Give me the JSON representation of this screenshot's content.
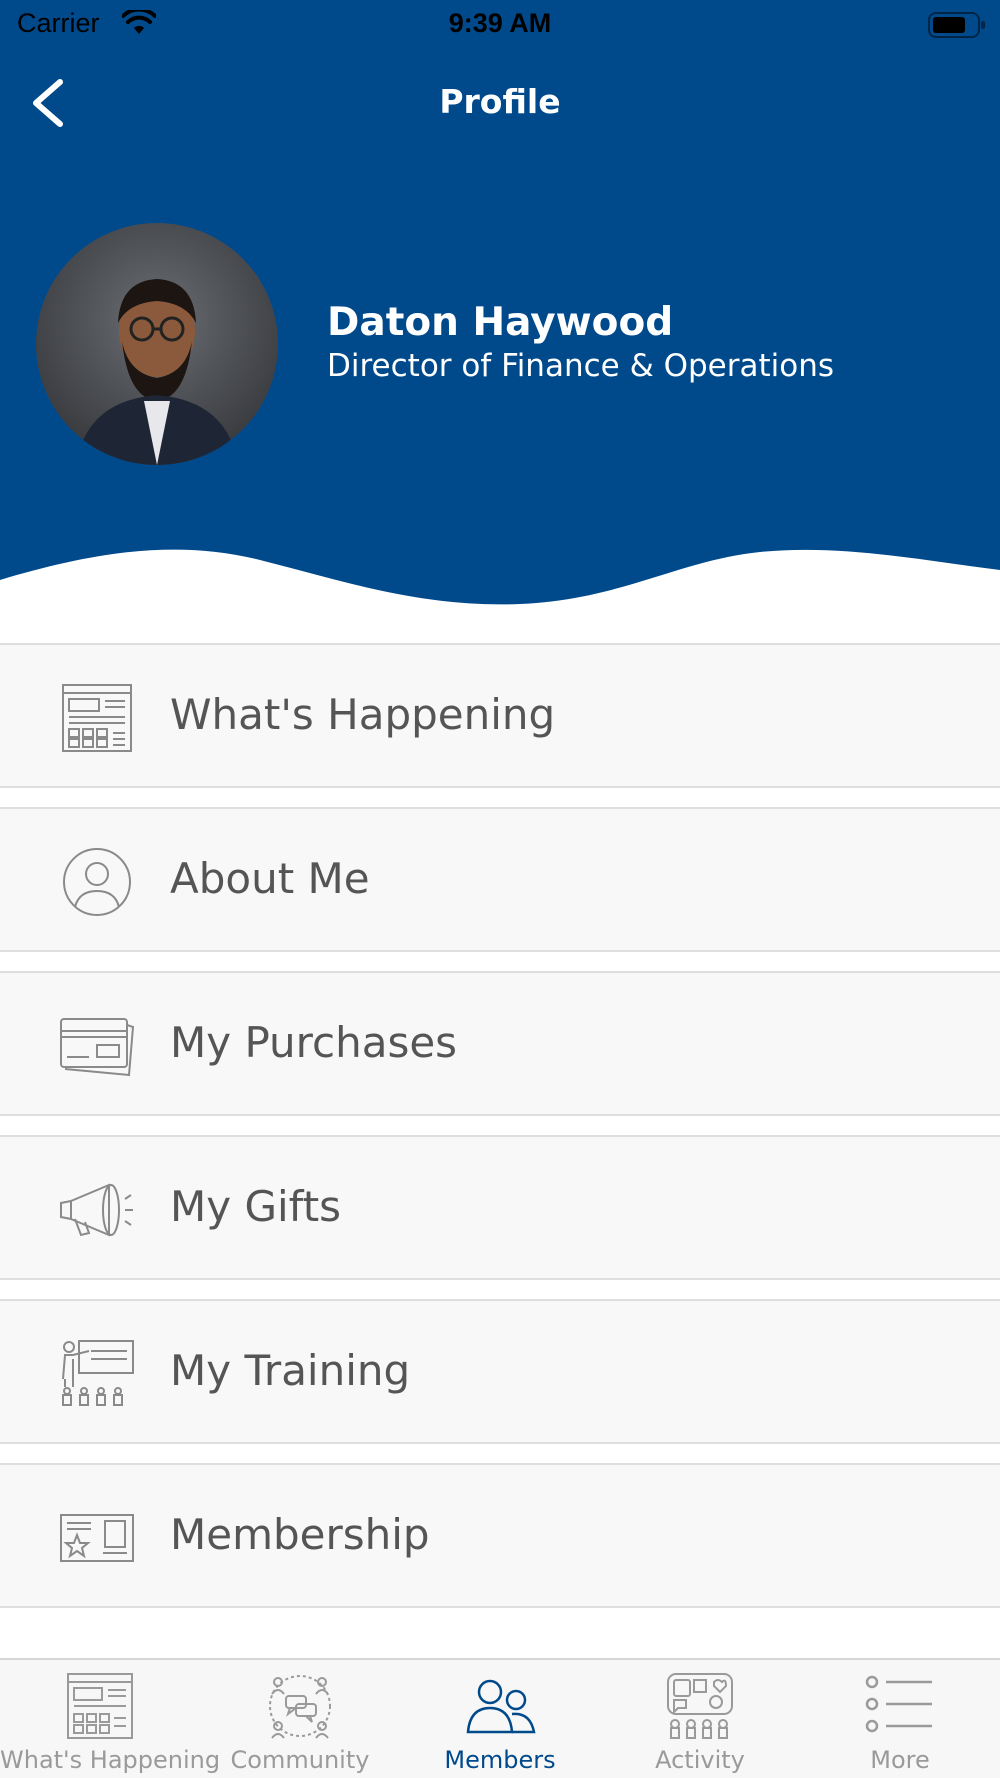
{
  "status_bar": {
    "carrier": "Carrier",
    "time": "9:39 AM"
  },
  "header": {
    "title": "Profile",
    "background_color": "#004a8c",
    "back_icon": "chevron-left-icon"
  },
  "profile": {
    "name": "Daton Haywood",
    "role": "Director of Finance & Operations"
  },
  "menu": {
    "items": [
      {
        "label": "What's Happening",
        "icon": "newspaper-icon"
      },
      {
        "label": "About Me",
        "icon": "user-circle-icon"
      },
      {
        "label": "My Purchases",
        "icon": "credit-card-icon"
      },
      {
        "label": "My Gifts",
        "icon": "megaphone-icon"
      },
      {
        "label": "My Training",
        "icon": "presenter-board-icon"
      },
      {
        "label": "Membership",
        "icon": "membership-card-icon"
      }
    ]
  },
  "tab_bar": {
    "active_color": "#004a8c",
    "inactive_color": "#9a9a9a",
    "tabs": [
      {
        "label": "What's Happening",
        "icon": "newspaper-icon",
        "active": false
      },
      {
        "label": "Community",
        "icon": "community-chat-icon",
        "active": false
      },
      {
        "label": "Members",
        "icon": "members-icon",
        "active": true
      },
      {
        "label": "Activity",
        "icon": "activity-board-icon",
        "active": false
      },
      {
        "label": "More",
        "icon": "list-icon",
        "active": false
      }
    ]
  }
}
